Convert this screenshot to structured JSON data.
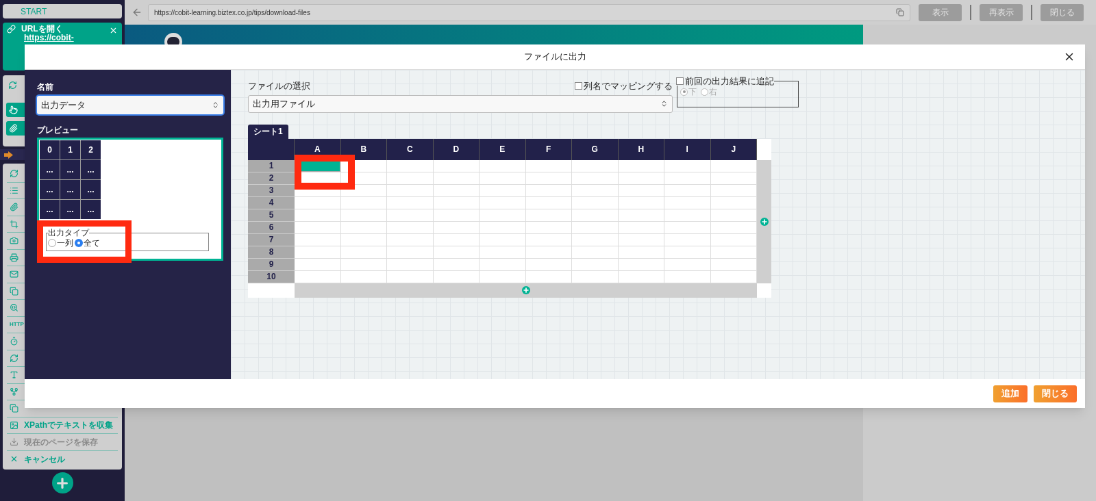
{
  "sidebar": {
    "start": "START",
    "url_card": {
      "title": "URLを開く",
      "url": "https://cobit-"
    },
    "http_badge": "HTTP",
    "actions": [
      {
        "label": "XPathでテキストを収集",
        "disabled": false
      },
      {
        "label": "現在のページを保存",
        "disabled": true
      },
      {
        "label": "キャンセル",
        "disabled": false
      }
    ]
  },
  "browser": {
    "url": "https://cobit-learning.biztex.co.jp/tips/download-files",
    "buttons": [
      "表示",
      "再表示",
      "閉じる"
    ]
  },
  "dialog": {
    "title": "ファイルに出力",
    "name": {
      "label": "名前",
      "value": "出力データ"
    },
    "preview": {
      "label": "プレビュー",
      "header": [
        "0",
        "1",
        "2"
      ],
      "rows": [
        [
          "...",
          "...",
          "..."
        ],
        [
          "...",
          "...",
          "..."
        ],
        [
          "...",
          "...",
          "..."
        ]
      ]
    },
    "output_type": {
      "legend": "出力タイプ",
      "options": [
        {
          "label": "一列",
          "selected": false
        },
        {
          "label": "全て",
          "selected": true
        }
      ]
    },
    "file": {
      "label": "ファイルの選択",
      "value": "出力用ファイル"
    },
    "map_by_column": {
      "label": "列名でマッピングする",
      "checked": false
    },
    "append": {
      "label": "前回の出力結果に追記",
      "checked": false,
      "options": [
        {
          "label": "下",
          "selected": true
        },
        {
          "label": "右",
          "selected": false
        }
      ]
    },
    "sheet_tabs": [
      {
        "label": "シート1",
        "selected": true
      }
    ],
    "grid": {
      "columns": [
        "A",
        "B",
        "C",
        "D",
        "E",
        "F",
        "G",
        "H",
        "I",
        "J"
      ],
      "rows": [
        {
          "label": "1",
          "cells_selected": [
            true,
            false,
            false,
            false,
            false,
            false,
            false,
            false,
            false,
            false
          ]
        },
        {
          "label": "2",
          "cells_selected": [
            false,
            false,
            false,
            false,
            false,
            false,
            false,
            false,
            false,
            false
          ]
        },
        {
          "label": "3",
          "cells_selected": [
            false,
            false,
            false,
            false,
            false,
            false,
            false,
            false,
            false,
            false
          ]
        },
        {
          "label": "4",
          "cells_selected": [
            false,
            false,
            false,
            false,
            false,
            false,
            false,
            false,
            false,
            false
          ]
        },
        {
          "label": "5",
          "cells_selected": [
            false,
            false,
            false,
            false,
            false,
            false,
            false,
            false,
            false,
            false
          ]
        },
        {
          "label": "6",
          "cells_selected": [
            false,
            false,
            false,
            false,
            false,
            false,
            false,
            false,
            false,
            false
          ]
        },
        {
          "label": "7",
          "cells_selected": [
            false,
            false,
            false,
            false,
            false,
            false,
            false,
            false,
            false,
            false
          ]
        },
        {
          "label": "8",
          "cells_selected": [
            false,
            false,
            false,
            false,
            false,
            false,
            false,
            false,
            false,
            false
          ]
        },
        {
          "label": "9",
          "cells_selected": [
            false,
            false,
            false,
            false,
            false,
            false,
            false,
            false,
            false,
            false
          ]
        },
        {
          "label": "10",
          "cells_selected": [
            false,
            false,
            false,
            false,
            false,
            false,
            false,
            false,
            false,
            false
          ]
        }
      ]
    },
    "buttons": [
      "追加",
      "閉じる"
    ]
  }
}
